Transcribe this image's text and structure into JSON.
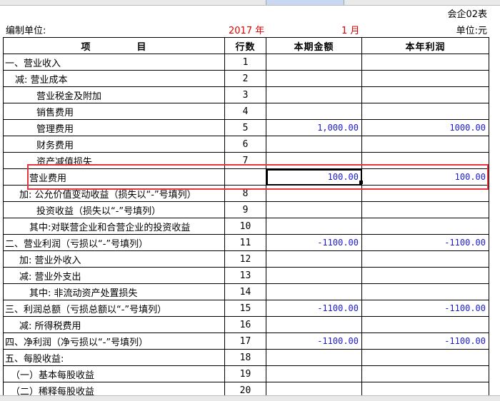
{
  "header": {
    "form_code": "会企02表",
    "unit_label": "编制单位:",
    "year": "2017 年",
    "month": "1 月",
    "currency": "单位:元"
  },
  "columns": {
    "item_a": "项",
    "item_b": "目",
    "line_no": "行数",
    "period_amount": "本期金额",
    "ytd_profit": "本年利润"
  },
  "rows": [
    {
      "item": "一、营业收入",
      "no": "1",
      "period": "",
      "ytd": ""
    },
    {
      "item": "减: 营业成本",
      "no": "2",
      "period": "",
      "ytd": ""
    },
    {
      "item": "营业税金及附加",
      "no": "3",
      "period": "",
      "ytd": ""
    },
    {
      "item": "销售费用",
      "no": "4",
      "period": "",
      "ytd": ""
    },
    {
      "item": "管理费用",
      "no": "5",
      "period": "1,000.00",
      "ytd": "1000.00"
    },
    {
      "item": "财务费用",
      "no": "6",
      "period": "",
      "ytd": ""
    },
    {
      "item": "资产减值损失",
      "no": "7",
      "period": "",
      "ytd": ""
    },
    {
      "item": "营业费用",
      "no": "",
      "period": "100.00",
      "ytd": "100.00"
    },
    {
      "item": "加: 公允价值变动收益（损失以“-”号填列）",
      "no": "8",
      "period": "",
      "ytd": ""
    },
    {
      "item": "投资收益（损失以“-”号填列）",
      "no": "9",
      "period": "",
      "ytd": ""
    },
    {
      "item": "其中:对联营企业和合营企业的投资收益",
      "no": "10",
      "period": "",
      "ytd": ""
    },
    {
      "item": "二、营业利润（亏损以“-”号填列）",
      "no": "11",
      "period": "-1100.00",
      "ytd": "-1100.00"
    },
    {
      "item": "加: 营业外收入",
      "no": "12",
      "period": "",
      "ytd": ""
    },
    {
      "item": "减: 营业外支出",
      "no": "13",
      "period": "",
      "ytd": ""
    },
    {
      "item": "其中: 非流动资产处置损失",
      "no": "14",
      "period": "",
      "ytd": ""
    },
    {
      "item": "三、利润总额（亏损总额以“-”号填列）",
      "no": "15",
      "period": "-1100.00",
      "ytd": "-1100.00"
    },
    {
      "item": "减: 所得税费用",
      "no": "16",
      "period": "",
      "ytd": ""
    },
    {
      "item": "四、净利润（净亏损以“-”号填列）",
      "no": "17",
      "period": "-1100.00",
      "ytd": "-1100.00"
    },
    {
      "item": "五、每股收益:",
      "no": "18",
      "period": "",
      "ytd": ""
    },
    {
      "item": "（一）基本每股收益",
      "no": "19",
      "period": "",
      "ytd": ""
    },
    {
      "item": "（二）稀释每股收益",
      "no": "20",
      "period": "",
      "ytd": ""
    }
  ],
  "colors": {
    "amount_text": "#1a1ad0",
    "date_text": "#e00000",
    "highlight_border": "#e8323c"
  }
}
